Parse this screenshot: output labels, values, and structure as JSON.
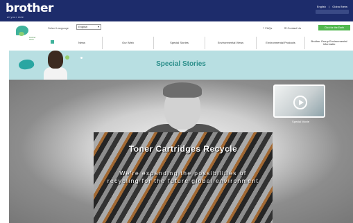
{
  "header": {
    "logo": "brother",
    "logo_sub": "at your side",
    "top_links": [
      "English",
      "|",
      "Global Netw"
    ]
  },
  "nav": {
    "brand_mini": "brother earth",
    "language_label": "Select Language",
    "language_value": "English",
    "faqs": "FAQs",
    "contact": "Contact Us",
    "green_button": "Click for the Earth",
    "menu": [
      {
        "label": "News"
      },
      {
        "label": "Our Wish"
      },
      {
        "label": "Special Stories"
      },
      {
        "label": "Environmental Views"
      },
      {
        "label": "Environmental Products"
      },
      {
        "label": "Brother Group Environmental Informatio"
      }
    ]
  },
  "banner": {
    "title": "Special Stories"
  },
  "hero": {
    "thumbnail_label": "Special Movie",
    "video_title": "Toner Cartridges Recycle",
    "video_subtitle_line1": "We're expanding the possibilities of",
    "video_subtitle_line2": "recycling for the future global environment"
  },
  "colors": {
    "top_bar": "#1d2c6b",
    "banner": "#b8dfe2",
    "title_teal": "#2c8f8b",
    "green_button": "#52b84f"
  }
}
